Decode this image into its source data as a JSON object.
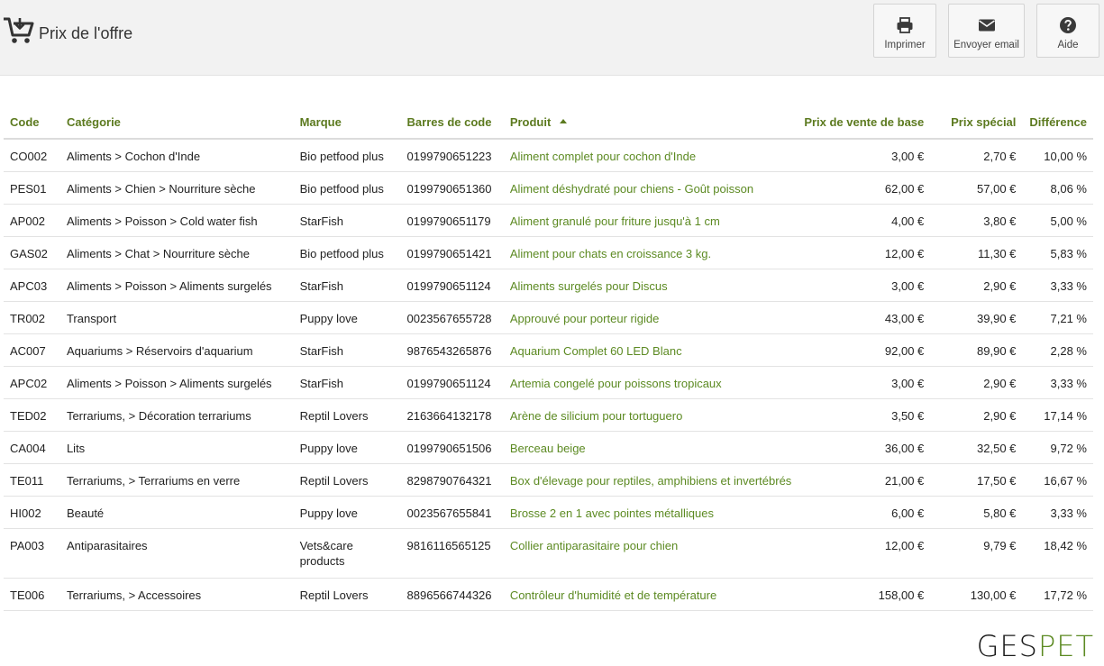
{
  "header": {
    "title": "Prix de l'offre",
    "title_icon": "cart-icon",
    "buttons": {
      "print": {
        "label": "Imprimer",
        "icon": "printer-icon"
      },
      "email": {
        "label": "Envoyer email",
        "icon": "envelope-icon"
      },
      "help": {
        "label": "Aide",
        "icon": "help-icon"
      }
    }
  },
  "table": {
    "sorted_by": "Produit",
    "sort_direction": "ascending",
    "columns": {
      "code": "Code",
      "category": "Catégorie",
      "brand": "Marque",
      "barcode": "Barres de code",
      "product": "Produit",
      "base_price": "Prix de vente de base",
      "special_price": "Prix  spécial",
      "difference": "Différence"
    },
    "rows": [
      {
        "code": "CO002",
        "category": "Aliments > Cochon d'Inde",
        "brand": "Bio petfood plus",
        "barcode": "0199790651223",
        "product": "Aliment complet pour cochon d'Inde",
        "base_price": "3,00 €",
        "special_price": "2,70 €",
        "difference": "10,00 %"
      },
      {
        "code": "PES01",
        "category": "Aliments > Chien > Nourriture sèche",
        "brand": "Bio petfood plus",
        "barcode": "0199790651360",
        "product": "Aliment déshydraté pour chiens - Goût poisson",
        "base_price": "62,00 €",
        "special_price": "57,00 €",
        "difference": "8,06 %"
      },
      {
        "code": "AP002",
        "category": "Aliments > Poisson > Cold water fish",
        "brand": "StarFish",
        "barcode": "0199790651179",
        "product": "Aliment granulé pour friture jusqu'à 1 cm",
        "base_price": "4,00 €",
        "special_price": "3,80 €",
        "difference": "5,00 %"
      },
      {
        "code": "GAS02",
        "category": "Aliments > Chat > Nourriture sèche",
        "brand": "Bio petfood plus",
        "barcode": "0199790651421",
        "product": "Aliment pour chats en croissance 3 kg.",
        "base_price": "12,00 €",
        "special_price": "11,30 €",
        "difference": "5,83 %"
      },
      {
        "code": "APC03",
        "category": "Aliments > Poisson > Aliments surgelés",
        "brand": "StarFish",
        "barcode": "0199790651124",
        "product": "Aliments surgelés pour Discus",
        "base_price": "3,00 €",
        "special_price": "2,90 €",
        "difference": "3,33 %"
      },
      {
        "code": "TR002",
        "category": "Transport",
        "brand": "Puppy love",
        "barcode": "0023567655728",
        "product": "Approuvé pour porteur rigide",
        "base_price": "43,00 €",
        "special_price": "39,90 €",
        "difference": "7,21 %"
      },
      {
        "code": "AC007",
        "category": "Aquariums > Réservoirs d'aquarium",
        "brand": "StarFish",
        "barcode": "9876543265876",
        "product": "Aquarium Complet 60 LED Blanc",
        "base_price": "92,00 €",
        "special_price": "89,90 €",
        "difference": "2,28 %"
      },
      {
        "code": "APC02",
        "category": "Aliments > Poisson > Aliments surgelés",
        "brand": "StarFish",
        "barcode": "0199790651124",
        "product": "Artemia congelé pour poissons tropicaux",
        "base_price": "3,00 €",
        "special_price": "2,90 €",
        "difference": "3,33 %"
      },
      {
        "code": "TED02",
        "category": "Terrariums, > Décoration terrariums",
        "brand": "Reptil Lovers",
        "barcode": "2163664132178",
        "product": "Arène de silicium pour tortuguero",
        "base_price": "3,50 €",
        "special_price": "2,90 €",
        "difference": "17,14 %"
      },
      {
        "code": "CA004",
        "category": "Lits",
        "brand": "Puppy love",
        "barcode": "0199790651506",
        "product": "Berceau beige",
        "base_price": "36,00 €",
        "special_price": "32,50 €",
        "difference": "9,72 %"
      },
      {
        "code": "TE011",
        "category": "Terrariums, > Terrariums en verre",
        "brand": "Reptil Lovers",
        "barcode": "8298790764321",
        "product": "Box d'élevage pour reptiles, amphibiens et invertébrés",
        "base_price": "21,00 €",
        "special_price": "17,50 €",
        "difference": "16,67 %"
      },
      {
        "code": "HI002",
        "category": "Beauté",
        "brand": "Puppy love",
        "barcode": "0023567655841",
        "product": "Brosse 2 en 1 avec pointes métalliques",
        "base_price": "6,00 €",
        "special_price": "5,80 €",
        "difference": "3,33 %"
      },
      {
        "code": "PA003",
        "category": "Antiparasitaires",
        "brand": "Vets&care products",
        "barcode": "9816116565125",
        "product": "Collier antiparasitaire pour chien",
        "base_price": "12,00 €",
        "special_price": "9,79 €",
        "difference": "18,42 %"
      },
      {
        "code": "TE006",
        "category": "Terrariums, > Accessoires",
        "brand": "Reptil Lovers",
        "barcode": "8896566744326",
        "product": "Contrôleur d'humidité et de température",
        "base_price": "158,00 €",
        "special_price": "130,00 €",
        "difference": "17,72 %"
      }
    ]
  },
  "footer": {
    "logo_part1": "GES",
    "logo_part2": "PET"
  },
  "colors": {
    "accent_green": "#5c8a22",
    "header_bg": "#f2f2f2"
  }
}
